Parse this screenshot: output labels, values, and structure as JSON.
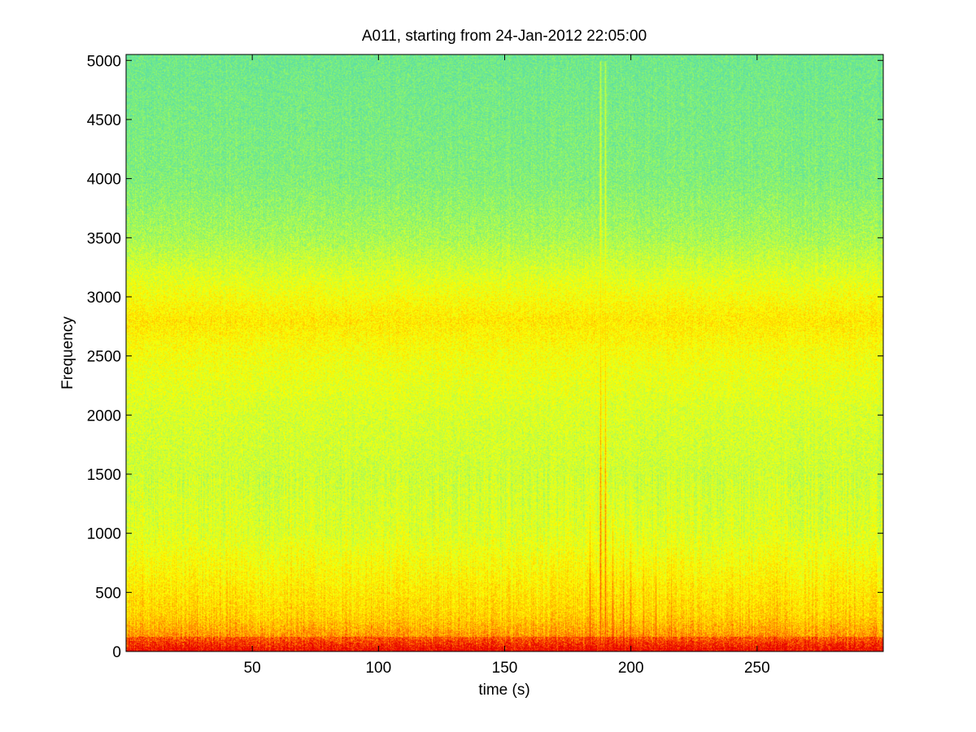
{
  "chart_data": {
    "type": "heatmap",
    "subtype": "spectrogram",
    "title": "A011, starting from 24-Jan-2012 22:05:00",
    "xlabel": "time (s)",
    "ylabel": "Frequency",
    "xlim": [
      0,
      300
    ],
    "ylim": [
      0,
      5050
    ],
    "x_ticks": [
      50,
      100,
      150,
      200,
      250
    ],
    "y_ticks": [
      0,
      500,
      1000,
      1500,
      2000,
      2500,
      3000,
      3500,
      4000,
      4500,
      5000
    ],
    "colormap": "jet",
    "colors": {
      "low": "#7CF07C",
      "mid_low": "#C8FF3C",
      "mid": "#FFFF00",
      "mid_high": "#FFA500",
      "high": "#FF0000",
      "frame": "#000000",
      "background": "#FFFFFF"
    },
    "background_intensity_by_frequency": [
      {
        "f": 0,
        "level": 0.92
      },
      {
        "f": 100,
        "level": 0.8
      },
      {
        "f": 300,
        "level": 0.7
      },
      {
        "f": 700,
        "level": 0.62
      },
      {
        "f": 1000,
        "level": 0.56
      },
      {
        "f": 1500,
        "level": 0.53
      },
      {
        "f": 2000,
        "level": 0.55
      },
      {
        "f": 2500,
        "level": 0.6
      },
      {
        "f": 2800,
        "level": 0.66
      },
      {
        "f": 3100,
        "level": 0.58
      },
      {
        "f": 3500,
        "level": 0.47
      },
      {
        "f": 4000,
        "level": 0.4
      },
      {
        "f": 5000,
        "level": 0.36
      }
    ],
    "energy_bursts": [
      {
        "t": 10,
        "fmax": 1400,
        "level": 0.85
      },
      {
        "t": 18,
        "fmax": 1300,
        "level": 0.8
      },
      {
        "t": 28,
        "fmax": 1250,
        "level": 0.85
      },
      {
        "t": 75,
        "fmax": 600,
        "level": 0.75
      },
      {
        "t": 118,
        "fmax": 2600,
        "level": 0.72
      },
      {
        "t": 170,
        "fmax": 900,
        "level": 0.82
      },
      {
        "t": 178,
        "fmax": 1000,
        "level": 0.85
      },
      {
        "t": 184,
        "fmax": 1700,
        "level": 0.95
      },
      {
        "t": 188,
        "fmax": 5000,
        "level": 0.9
      },
      {
        "t": 190,
        "fmax": 5000,
        "level": 0.88
      },
      {
        "t": 193,
        "fmax": 1600,
        "level": 0.95
      },
      {
        "t": 197,
        "fmax": 1400,
        "level": 0.92
      },
      {
        "t": 200,
        "fmax": 1500,
        "level": 0.92
      },
      {
        "t": 205,
        "fmax": 1450,
        "level": 0.9
      },
      {
        "t": 210,
        "fmax": 1400,
        "level": 0.92
      },
      {
        "t": 216,
        "fmax": 1350,
        "level": 0.9
      },
      {
        "t": 222,
        "fmax": 1100,
        "level": 0.82
      },
      {
        "t": 240,
        "fmax": 800,
        "level": 0.78
      },
      {
        "t": 257,
        "fmax": 1400,
        "level": 0.82
      },
      {
        "t": 285,
        "fmax": 700,
        "level": 0.75
      }
    ]
  }
}
